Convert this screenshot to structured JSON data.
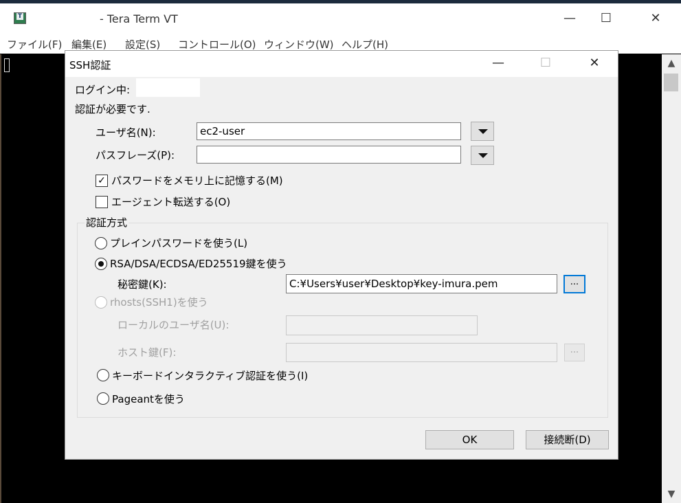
{
  "window": {
    "title": "- Tera Term VT",
    "minimize": "—",
    "maximize": "☐",
    "close": "✕"
  },
  "menu": [
    "ファイル(F)",
    "編集(E)",
    "設定(S)",
    "コントロール(O)",
    "ウィンドウ(W)",
    "ヘルプ(H)"
  ],
  "scrollbar": {
    "up": "▲",
    "down": "▼"
  },
  "dialog": {
    "title": "SSH認証",
    "minimize": "—",
    "maximize": "☐",
    "close": "✕",
    "logging_in_label": "ログイン中:",
    "logging_in_value": "",
    "auth_required": "認証が必要です.",
    "username_label": "ユーザ名(N):",
    "username_value": "ec2-user",
    "passphrase_label": "パスフレーズ(P):",
    "passphrase_value": "",
    "remember_password": {
      "label": "パスワードをメモリ上に記憶する(M)",
      "checked": true,
      "mark": "✓"
    },
    "agent_forward": {
      "label": "エージェント転送する(O)",
      "checked": false
    },
    "auth_method_title": "認証方式",
    "methods": {
      "plain_password": "プレインパスワードを使う(L)",
      "rsa_key": "RSA/DSA/ECDSA/ED25519鍵を使う",
      "rhosts": "rhosts(SSH1)を使う",
      "keyboard_interactive": "キーボードインタラクティブ認証を使う(I)",
      "pageant": "Pageantを使う"
    },
    "selected_method": "rsa_key",
    "private_key_label": "秘密鍵(K):",
    "private_key_value": "C:¥Users¥user¥Desktop¥key-imura.pem",
    "browse": "...",
    "local_user_label": "ローカルのユーザ名(U):",
    "host_key_label": "ホスト鍵(F):",
    "ok": "OK",
    "disconnect": "接続断(D)"
  },
  "colors": {
    "dialog_bg": "#f0f0f0",
    "focus_border": "#0078d7",
    "terminal_bg": "#000000"
  }
}
